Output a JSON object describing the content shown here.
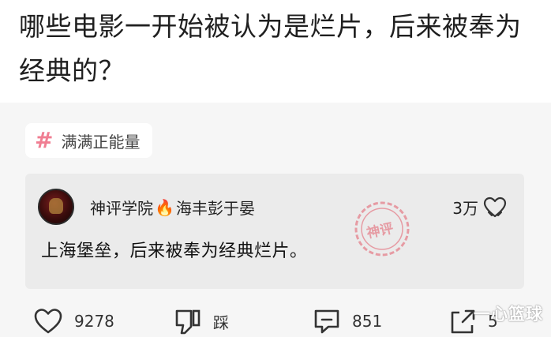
{
  "question": {
    "title": "哪些电影一开始被认为是烂片，后来被奉为经典的？"
  },
  "topic": {
    "icon": "hash-icon",
    "label": "满满正能量"
  },
  "comment": {
    "author_prefix": "神评学院",
    "author_badge": "fire-icon",
    "author_name": "海丰彭于晏",
    "likes": "3万",
    "text": "上海堡垒，后来被奉为经典烂片。",
    "stamp_text": "神评"
  },
  "actions": {
    "like_count": "9278",
    "dislike_label": "踩",
    "comment_count": "851",
    "share_count": "5"
  },
  "watermark": "一心篮球",
  "colors": {
    "accent_pink": "#f07e92",
    "card_bg": "#ebebeb",
    "page_bg": "#f6f6f6"
  }
}
